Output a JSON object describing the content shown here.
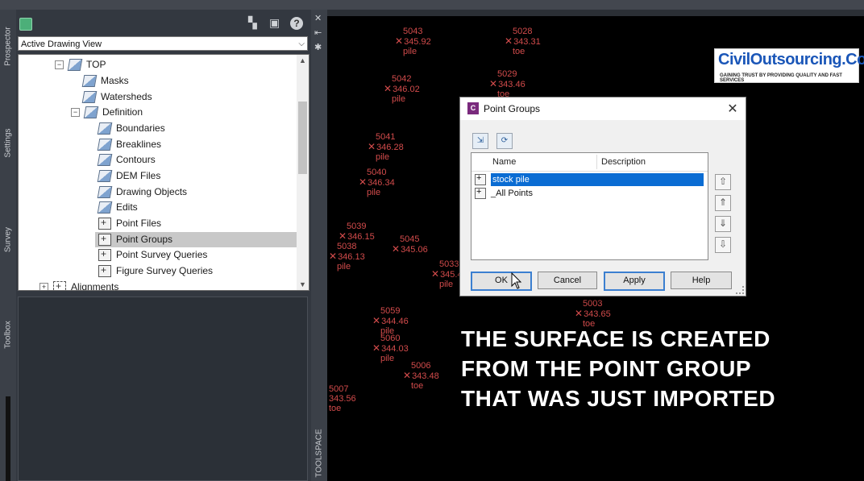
{
  "panel": {
    "view_select": "Active Drawing View",
    "tabs": [
      "Prospector",
      "Settings",
      "Survey",
      "Toolbox"
    ],
    "tree": [
      {
        "label": "TOP",
        "indent": 1,
        "expander": "-"
      },
      {
        "label": "Masks",
        "indent": 2
      },
      {
        "label": "Watersheds",
        "indent": 2
      },
      {
        "label": "Definition",
        "indent": 2,
        "expander": "-"
      },
      {
        "label": "Boundaries",
        "indent": 3
      },
      {
        "label": "Breaklines",
        "indent": 3
      },
      {
        "label": "Contours",
        "indent": 3
      },
      {
        "label": "DEM Files",
        "indent": 3
      },
      {
        "label": "Drawing Objects",
        "indent": 3
      },
      {
        "label": "Edits",
        "indent": 3
      },
      {
        "label": "Point Files",
        "indent": 3
      },
      {
        "label": "Point Groups",
        "indent": 3,
        "selected": true
      },
      {
        "label": "Point Survey Queries",
        "indent": 3
      },
      {
        "label": "Figure Survey Queries",
        "indent": 3
      },
      {
        "label": "Alignments",
        "indent": 0,
        "expander": "+"
      }
    ]
  },
  "right_strip": {
    "toolspace_label": "TOOLSPACE"
  },
  "dialog": {
    "title": "Point Groups",
    "app_icon": "C",
    "columns": [
      "Name",
      "Description"
    ],
    "rows": [
      {
        "name": "stock pile",
        "selected": true
      },
      {
        "name": "_All Points",
        "selected": false
      }
    ],
    "buttons": {
      "ok": "OK",
      "cancel": "Cancel",
      "apply": "Apply",
      "help": "Help"
    }
  },
  "logo": {
    "title": "CivilOutsourcing.Com",
    "tagline": "GAINING TRUST BY PROVIDING QUALITY AND FAST SERVICES"
  },
  "caption": [
    "THE SURFACE IS CREATED",
    "FROM THE POINT GROUP",
    "THAT WAS JUST IMPORTED"
  ],
  "points": [
    {
      "id": "5043",
      "elev": "345.92",
      "desc": "pile"
    },
    {
      "id": "5028",
      "elev": "343.31",
      "desc": "toe"
    },
    {
      "id": "5042",
      "elev": "346.02",
      "desc": "pile"
    },
    {
      "id": "5029",
      "elev": "343.46",
      "desc": "toe"
    },
    {
      "id": "5041",
      "elev": "346.28",
      "desc": "pile"
    },
    {
      "id": "5040",
      "elev": "346.34",
      "desc": "pile"
    },
    {
      "id": "5039",
      "elev": "346.15",
      "desc": "pile"
    },
    {
      "id": "5038",
      "elev": "346.13",
      "desc": "pile"
    },
    {
      "id": "5045",
      "elev": "345.06",
      "desc": "pile"
    },
    {
      "id": "5059",
      "elev": "344.46",
      "desc": "pile"
    },
    {
      "id": "5060",
      "elev": "344.03",
      "desc": "pile"
    },
    {
      "id": "5006",
      "elev": "343.48",
      "desc": "toe"
    },
    {
      "id": "5007",
      "elev": "343.56",
      "desc": "toe"
    },
    {
      "id": "5003",
      "elev": "343.65",
      "desc": "toe"
    },
    {
      "id": "5033",
      "elev": "345.4",
      "desc": "pile"
    }
  ]
}
